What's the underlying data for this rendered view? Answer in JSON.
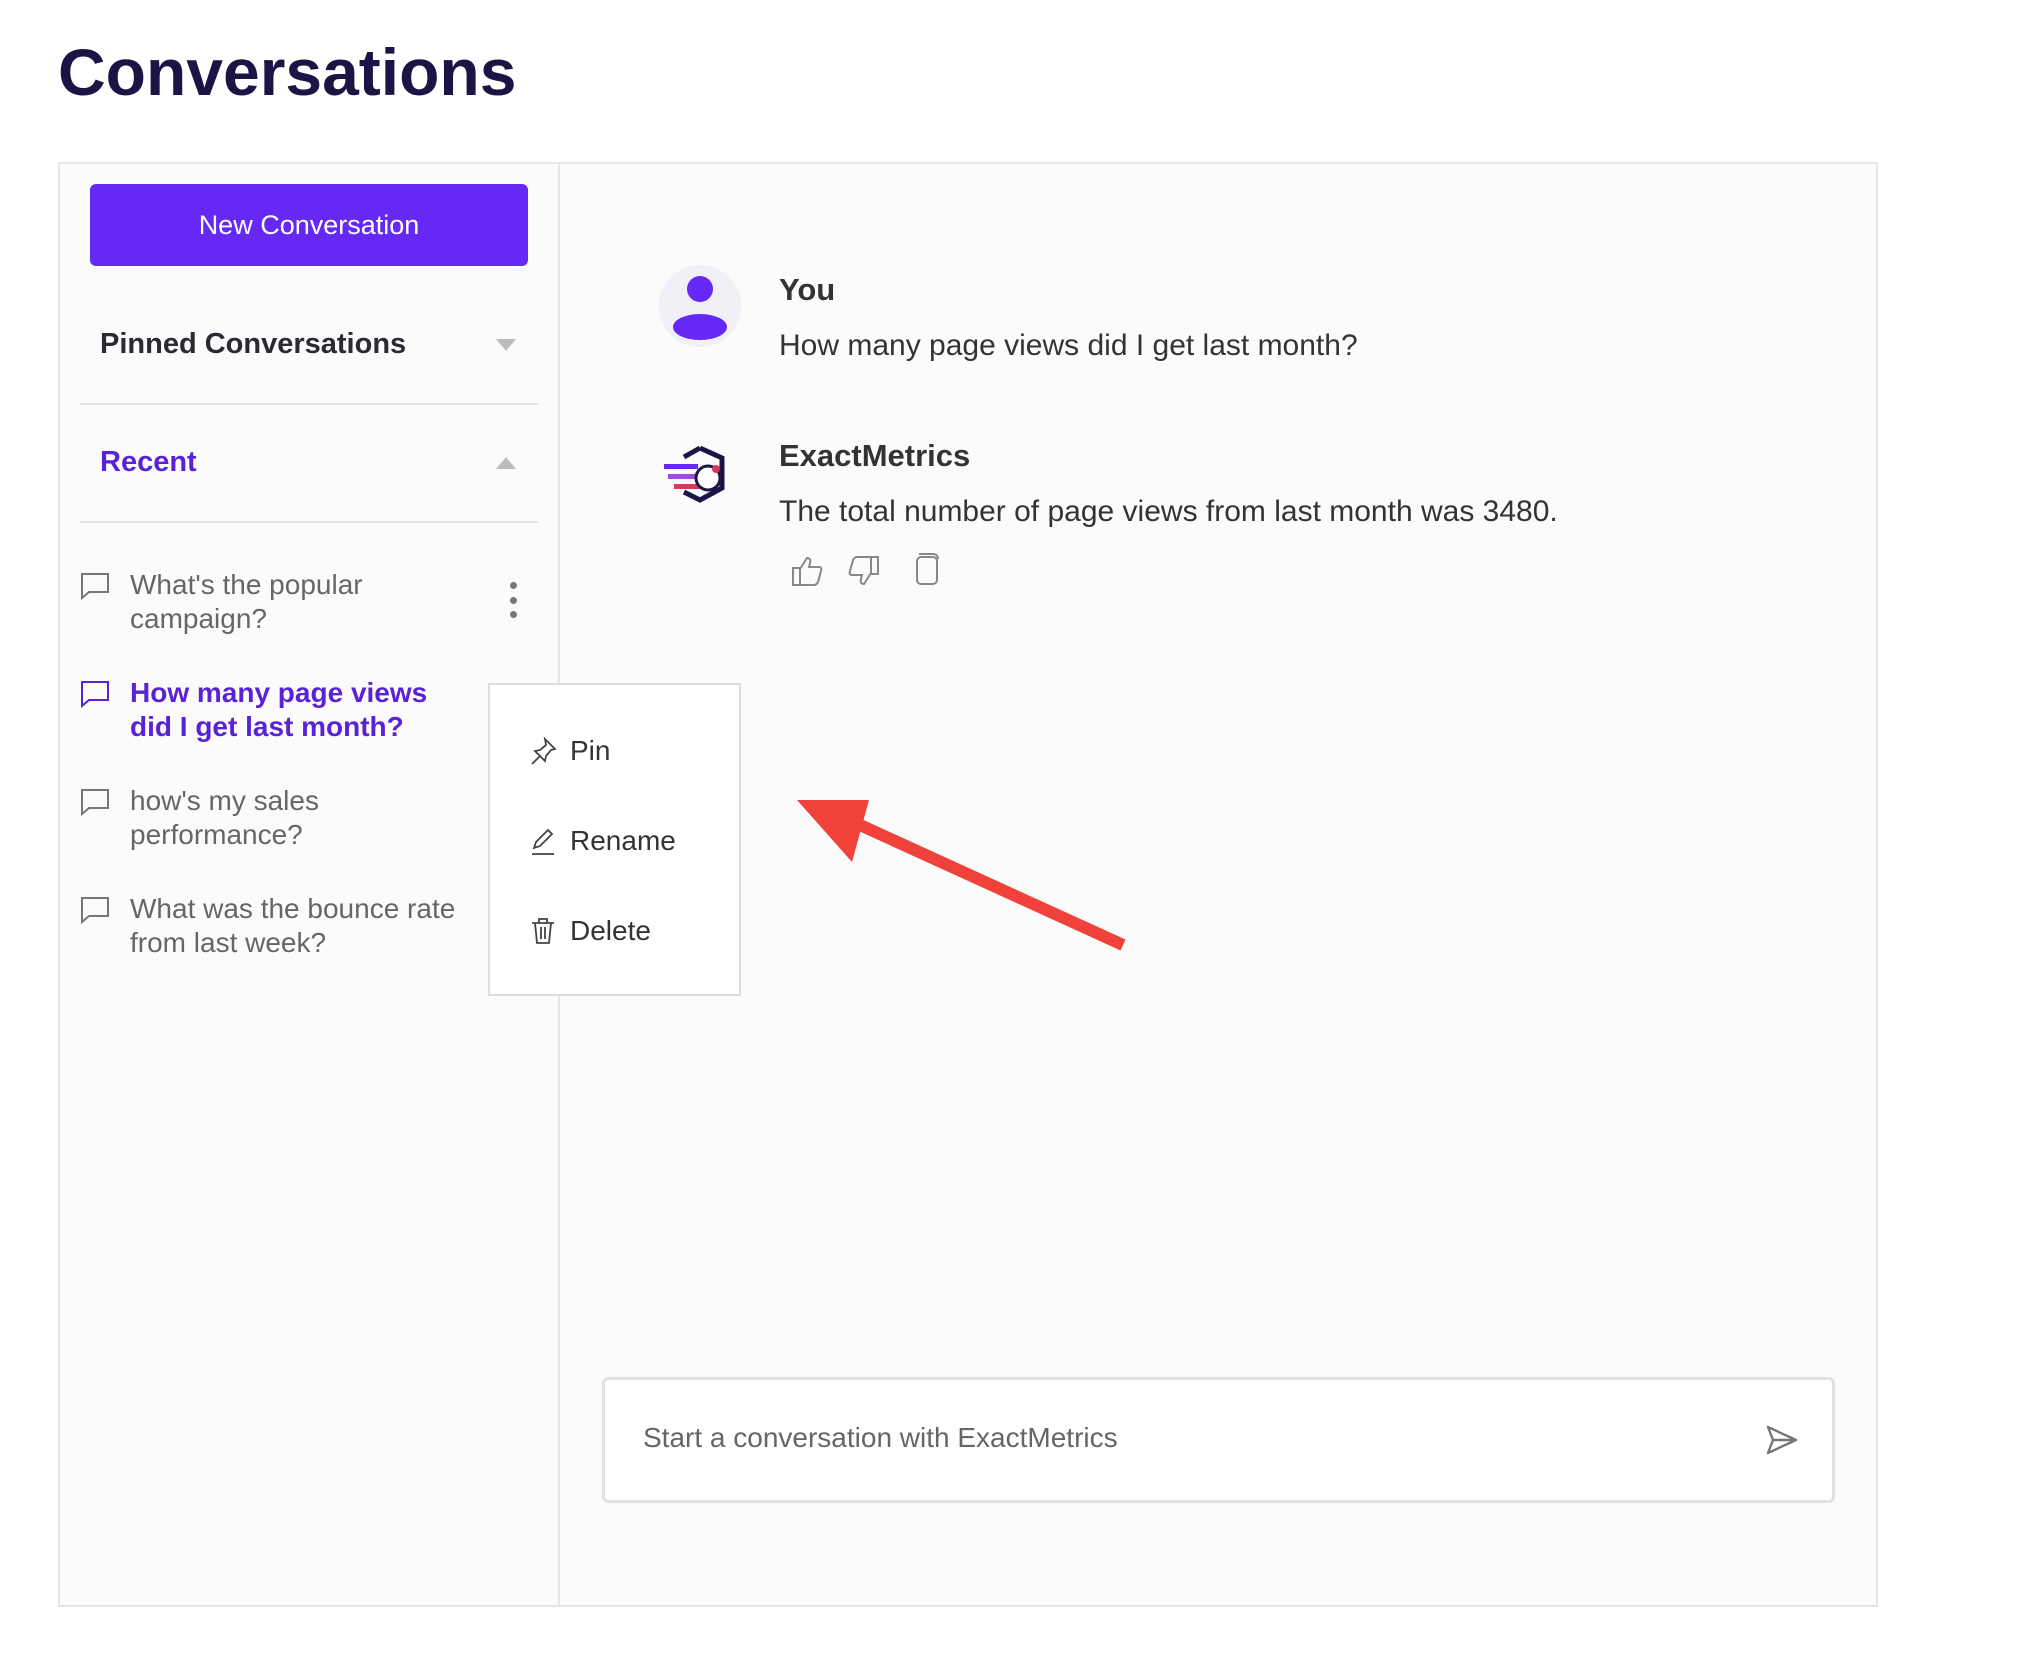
{
  "page": {
    "title": "Conversations"
  },
  "sidebar": {
    "new_button": "New Conversation",
    "pinned_label": "Pinned Conversations",
    "recent_label": "Recent",
    "items": [
      {
        "label": "What's the popular campaign?",
        "lines": [
          "What's the popular",
          "campaign?"
        ]
      },
      {
        "label": "How many page views did I get last month?",
        "lines": [
          "How many page views",
          "did I get last month?"
        ],
        "active": true
      },
      {
        "label": "how's my sales performance?",
        "lines": [
          "how's my sales",
          "performance?"
        ]
      },
      {
        "label": "What was the bounce rate from last week?",
        "lines": [
          "What was the bounce rate",
          "from last week?"
        ]
      }
    ]
  },
  "context_menu": {
    "pin": "Pin",
    "rename": "Rename",
    "delete": "Delete"
  },
  "chat": {
    "messages": [
      {
        "author": "You",
        "text": "How many page views did I get last month?"
      },
      {
        "author": "ExactMetrics",
        "text": "The total number of page views from last month was 3480."
      }
    ],
    "input_placeholder": "Start a conversation with ExactMetrics"
  },
  "colors": {
    "accent": "#6528f5",
    "annotation_arrow": "#f0413a",
    "title": "#1d1446"
  }
}
